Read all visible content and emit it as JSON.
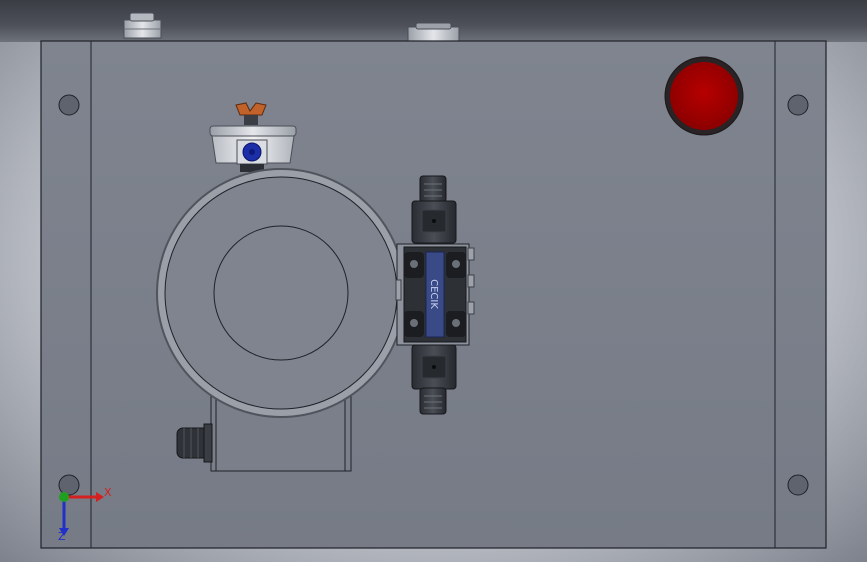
{
  "viewport": {
    "title": "",
    "model_colors": {
      "plate": "#7e838e",
      "edge": "#1f2228",
      "stop_button": "#a80000",
      "knob": "#c0622a",
      "sight_glass": "#1d2fa8"
    }
  },
  "triad": {
    "x_label": "X",
    "z_label": "Z",
    "x_color": "#d42020",
    "z_color": "#2030c8",
    "origin_color": "#20a020"
  },
  "valve": {
    "vertical_text": "CECIK"
  }
}
